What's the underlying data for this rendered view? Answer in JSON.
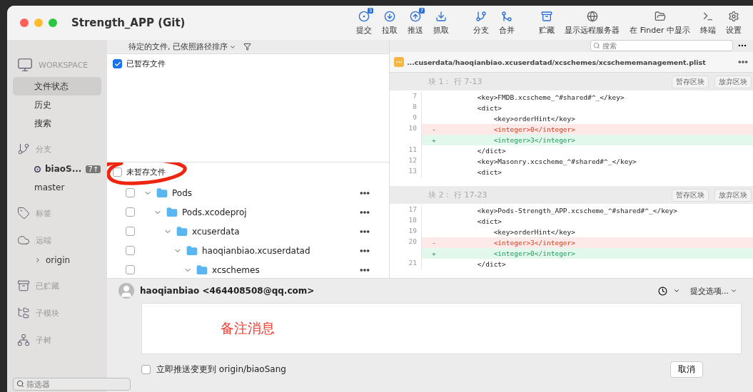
{
  "window": {
    "title": "Strength_APP (Git)"
  },
  "toolbar": [
    {
      "label": "提交",
      "badge": "3"
    },
    {
      "label": "拉取"
    },
    {
      "label": "推送",
      "badge": "7"
    },
    {
      "label": "抓取"
    },
    {
      "label": "分支"
    },
    {
      "label": "合并"
    },
    {
      "label": "贮藏"
    },
    {
      "label": "显示远程服务器"
    },
    {
      "label": "在 Finder 中显示"
    },
    {
      "label": "终端"
    },
    {
      "label": "设置"
    }
  ],
  "sidebar": {
    "sections": [
      {
        "title": "WORKSPACE",
        "items": [
          {
            "label": "文件状态",
            "selected": true
          },
          {
            "label": "历史",
            "selected": false
          },
          {
            "label": "搜索",
            "selected": false
          }
        ]
      },
      {
        "title": "分支",
        "items": [
          {
            "label": "biaoS...",
            "selected": false,
            "current": true,
            "badge": "7↑"
          },
          {
            "label": "master",
            "selected": false,
            "current": false
          }
        ]
      },
      {
        "title": "标签"
      },
      {
        "title": "远端",
        "items": [
          {
            "label": "origin",
            "selected": false,
            "collapsed": true
          }
        ]
      },
      {
        "title": "已贮藏"
      },
      {
        "title": "子模块"
      },
      {
        "title": "子树"
      }
    ],
    "filter": {
      "placeholder": "筛选器"
    }
  },
  "file_pane": {
    "sort_label": "待定的文件, 已依照路径排序",
    "staged": {
      "label": "已暂存文件",
      "checked": true
    },
    "unstaged": {
      "label": "未暂存文件",
      "checked": false
    },
    "tree": [
      {
        "name": "Pods",
        "checked": false,
        "expanded": true,
        "children": [
          {
            "name": "Pods.xcodeproj",
            "checked": false,
            "expanded": true,
            "children": [
              {
                "name": "xcuserdata",
                "checked": false,
                "expanded": true,
                "children": [
                  {
                    "name": "haoqianbiao.xcuserdatad",
                    "checked": false,
                    "expanded": true,
                    "children": [
                      {
                        "name": "xcschemes",
                        "checked": false,
                        "expanded": true
                      }
                    ]
                  }
                ]
              }
            ]
          }
        ]
      }
    ]
  },
  "diff": {
    "search": {
      "placeholder": "搜索"
    },
    "file_path": "...cuserdata/haoqianbiao.xcuserdatad/xcschemes/xcschememanagement.plist",
    "hunks": [
      {
        "title": "块 1： 行 7-13",
        "stage_button": "暂存区块",
        "discard_button": "放弃区块",
        "lines": [
          {
            "kind": "context",
            "number": "7",
            "text": "        <key>FMDB.xcscheme_^#shared#^_</key>"
          },
          {
            "kind": "context",
            "number": "8",
            "text": "        <dict>"
          },
          {
            "kind": "context",
            "number": "9",
            "text": "            <key>orderHint</key>"
          },
          {
            "kind": "removed",
            "number": "10",
            "sign": "-",
            "text": "            <integer>0</integer>"
          },
          {
            "kind": "added",
            "sign": "+",
            "text": "            <integer>3</integer>"
          },
          {
            "kind": "context",
            "number": "11",
            "text": "        </dict>"
          },
          {
            "kind": "context",
            "number": "12",
            "text": "        <key>Masonry.xcscheme_^#shared#^_</key>"
          },
          {
            "kind": "context",
            "number": "13",
            "text": "        <dict>"
          }
        ]
      },
      {
        "title": "块 2： 行 17-23",
        "stage_button": "暂存区块",
        "discard_button": "放弃区块",
        "lines": [
          {
            "kind": "context",
            "number": "17",
            "text": "        <key>Pods-Strength_APP.xcscheme_^#shared#^_</key>"
          },
          {
            "kind": "context",
            "number": "18",
            "text": "        <dict>"
          },
          {
            "kind": "context",
            "number": "19",
            "text": "            <key>orderHint</key>"
          },
          {
            "kind": "removed",
            "number": "20",
            "sign": "-",
            "text": "            <integer>3</integer>"
          },
          {
            "kind": "added",
            "sign": "+",
            "text": "            <integer>0</integer>"
          },
          {
            "kind": "context",
            "number": "21",
            "text": "        </dict>"
          }
        ]
      }
    ]
  },
  "commit": {
    "author": "haoqianbiao <464408508@qq.com>",
    "options": "提交选项...",
    "annotation": "备注消息",
    "push_option": {
      "label": "立即推送变更到 origin/biaoSang",
      "checked": false
    },
    "cancel_button": "取消"
  }
}
